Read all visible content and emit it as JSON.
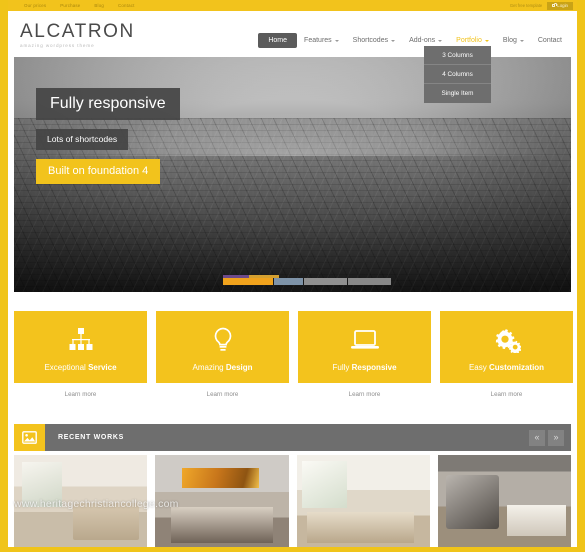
{
  "topbar": {
    "links": [
      "Our prices",
      "Purchase",
      "Blog",
      "Contact"
    ],
    "note": "Get free template",
    "login_label": "Login",
    "login_icon": "lock-icon"
  },
  "header": {
    "logo_title": "ALCATRON",
    "logo_subtitle": "amazing wordpress theme"
  },
  "nav": {
    "items": [
      {
        "label": "Home",
        "state": "active",
        "caret": false
      },
      {
        "label": "Features",
        "state": "default",
        "caret": true
      },
      {
        "label": "Shortcodes",
        "state": "default",
        "caret": true
      },
      {
        "label": "Add-ons",
        "state": "default",
        "caret": true
      },
      {
        "label": "Portfolio",
        "state": "open",
        "caret": true
      },
      {
        "label": "Blog",
        "state": "default",
        "caret": true
      },
      {
        "label": "Contact",
        "state": "default",
        "caret": false
      }
    ],
    "dropdown": {
      "parent": "Portfolio",
      "items": [
        "3 Columns",
        "4 Columns",
        "Single Item"
      ]
    }
  },
  "hero": {
    "caption_1": "Fully responsive",
    "caption_2": "Lots of shortcodes",
    "caption_3": "Built on foundation 4",
    "image_alt": "aerial grayscale cityscape",
    "progress_active_color": "#f0a21c",
    "slide_count": 4,
    "active_slide": 1
  },
  "features": {
    "accent_color": "#f3c31d",
    "more_label": "Learn more",
    "items": [
      {
        "icon": "sitemap-icon",
        "label_light": "Exceptional ",
        "label_bold": "Service"
      },
      {
        "icon": "lightbulb-icon",
        "label_light": "Amazing ",
        "label_bold": "Design"
      },
      {
        "icon": "laptop-icon",
        "label_light": "Fully ",
        "label_bold": "Responsive"
      },
      {
        "icon": "gears-icon",
        "label_light": "Easy ",
        "label_bold": "Customization"
      }
    ]
  },
  "recent_works": {
    "title": "RECENT WORKS",
    "icon": "image-icon",
    "prev_label": "«",
    "next_label": "»"
  },
  "portfolio": {
    "thumbs": [
      {
        "alt": "bright bedroom with TV and rug"
      },
      {
        "alt": "bedroom with abstract orange artwork"
      },
      {
        "alt": "white bedroom with large windows"
      },
      {
        "alt": "lounge chair with open book on table"
      }
    ]
  },
  "watermark": {
    "text": "www.heritagechristiancollege.com"
  }
}
